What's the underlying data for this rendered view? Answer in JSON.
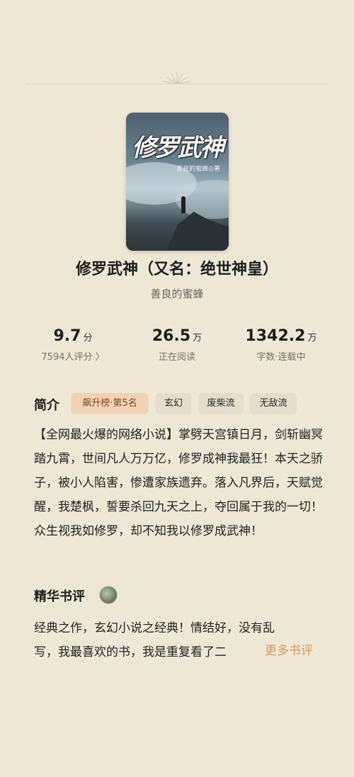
{
  "book": {
    "cover_title": "修罗武神",
    "cover_author": "善良的蜜蜂◎著",
    "title": "修罗武神（又名：绝世神皇）",
    "author": "善良的蜜蜂"
  },
  "stats": [
    {
      "value": "9.7",
      "unit": "分",
      "label": "7594人评分 〉"
    },
    {
      "value": "26.5",
      "unit": "万",
      "label": "正在阅读"
    },
    {
      "value": "1342.2",
      "unit": "万",
      "label": "字数·连载中"
    }
  ],
  "intro": {
    "heading": "简介",
    "tags": [
      "飙升榜·第5名",
      "玄幻",
      "废柴流",
      "无敌流"
    ],
    "text": "【全网最火爆的网络小说】掌劈天宫镇日月，剑斩幽冥踏九霄，世间凡人万万亿，修罗成神我最狂！本天之骄子，被小人陷害，惨遭家族遗弃。落入凡界后，天赋觉醒，我楚枫，誓要杀回九天之上，夺回属于我的一切！众生视我如修罗，却不知我以修罗成武神！"
  },
  "reviews": {
    "heading": "精华书评",
    "line1": "经典之作，玄幻小说之经典！情结好，没有乱",
    "line2": "写，我最喜欢的书，我是重复看了二",
    "more": "更多书评"
  }
}
